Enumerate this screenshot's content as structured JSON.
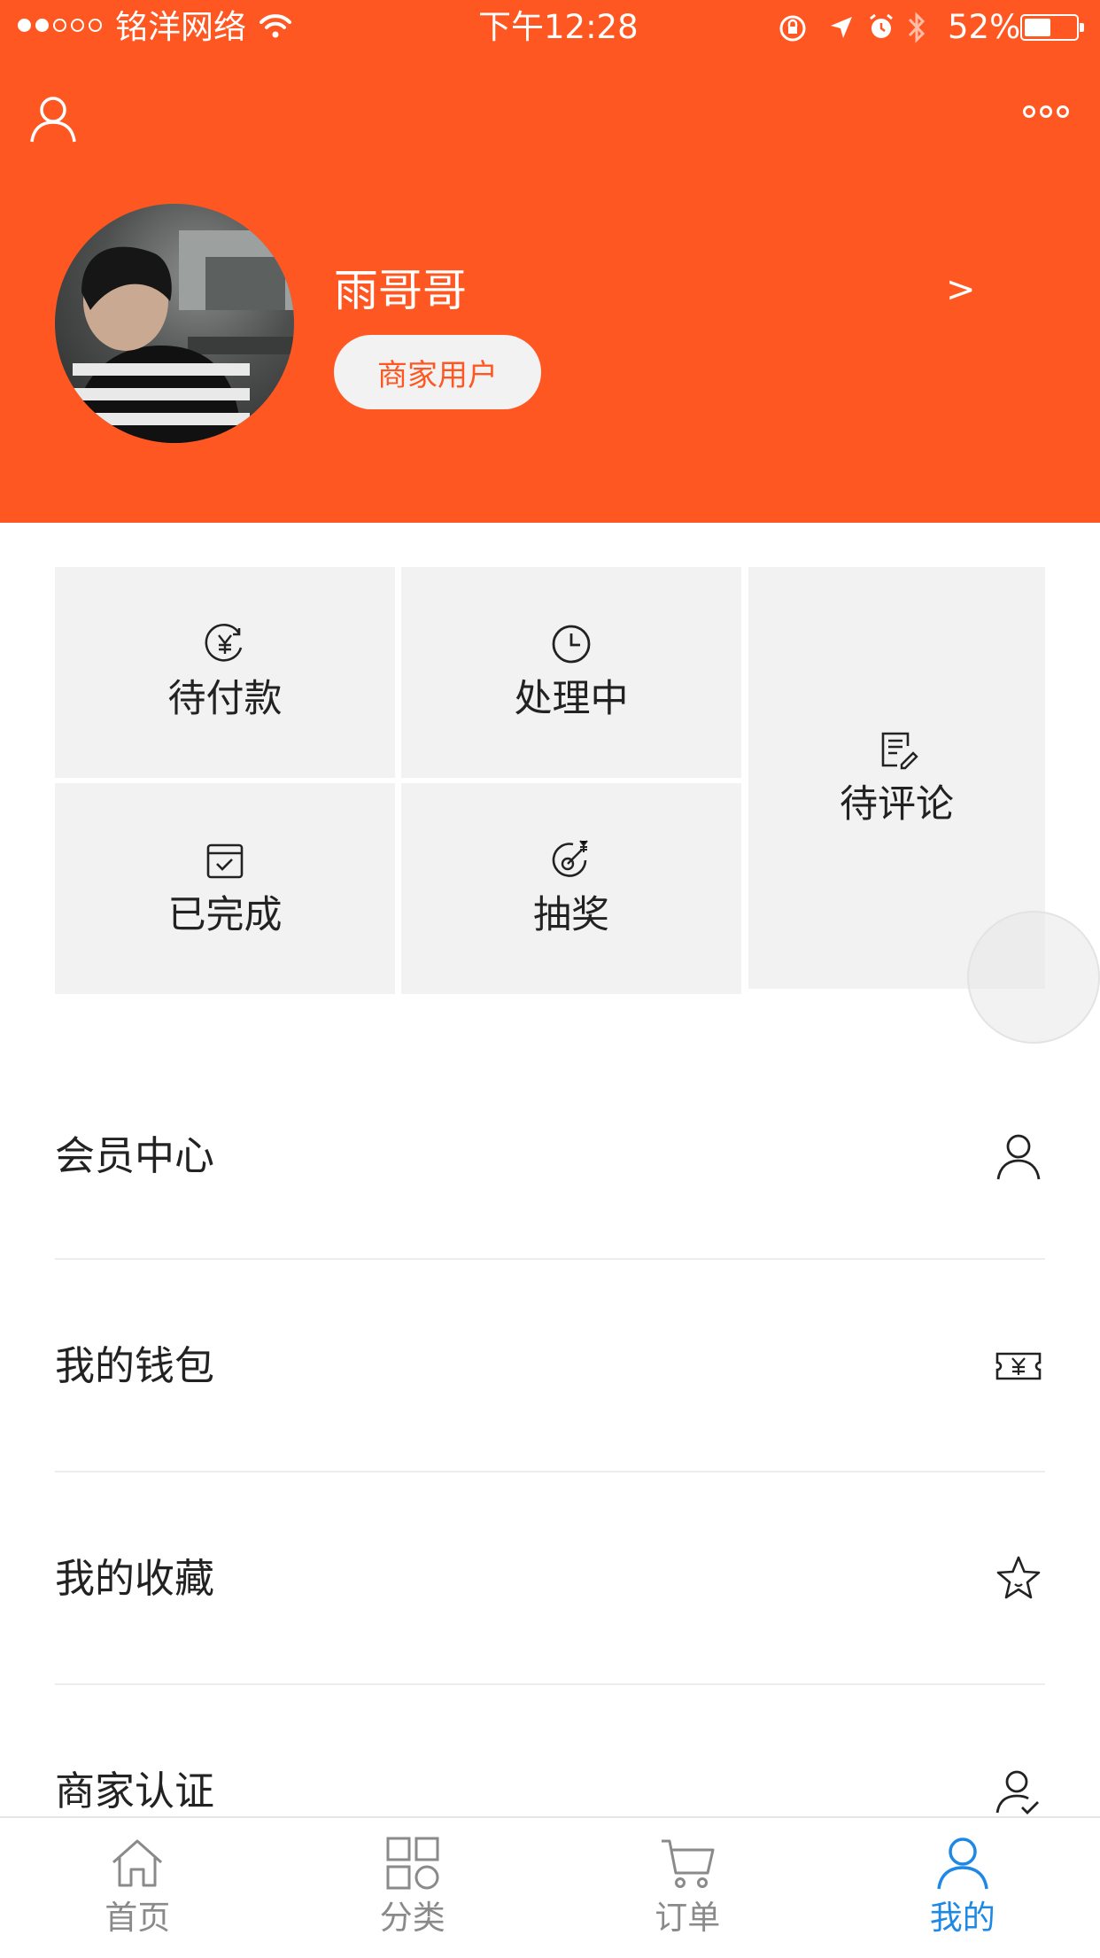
{
  "status_bar": {
    "carrier": "铭洋网络",
    "time": "下午12:28",
    "battery": "52%",
    "battery_level": 0.52
  },
  "profile": {
    "username": "雨哥哥",
    "badge": "商家用户",
    "chevron": ">"
  },
  "orders": {
    "tiles": [
      {
        "label": "待付款",
        "icon": "yuan-cycle-icon"
      },
      {
        "label": "处理中",
        "icon": "clock-icon"
      },
      {
        "label": "待评论",
        "icon": "edit-doc-icon"
      },
      {
        "label": "已完成",
        "icon": "calendar-check-icon"
      },
      {
        "label": "抽奖",
        "icon": "lottery-icon"
      }
    ]
  },
  "menu": [
    {
      "label": "会员中心",
      "icon": "user-icon"
    },
    {
      "label": "我的钱包",
      "icon": "ticket-yuan-icon"
    },
    {
      "label": "我的收藏",
      "icon": "star-icon"
    },
    {
      "label": "商家认证",
      "icon": "user-check-icon"
    }
  ],
  "tabbar": [
    {
      "label": "首页",
      "icon": "home-icon"
    },
    {
      "label": "分类",
      "icon": "grid-icon"
    },
    {
      "label": "订单",
      "icon": "cart-icon"
    },
    {
      "label": "我的",
      "icon": "profile-icon",
      "active": true
    }
  ],
  "colors": {
    "brand": "#FF5722",
    "tile": "#F2F2F2",
    "active_tab": "#1E88E5",
    "inactive_tab": "#8A8A8A"
  }
}
